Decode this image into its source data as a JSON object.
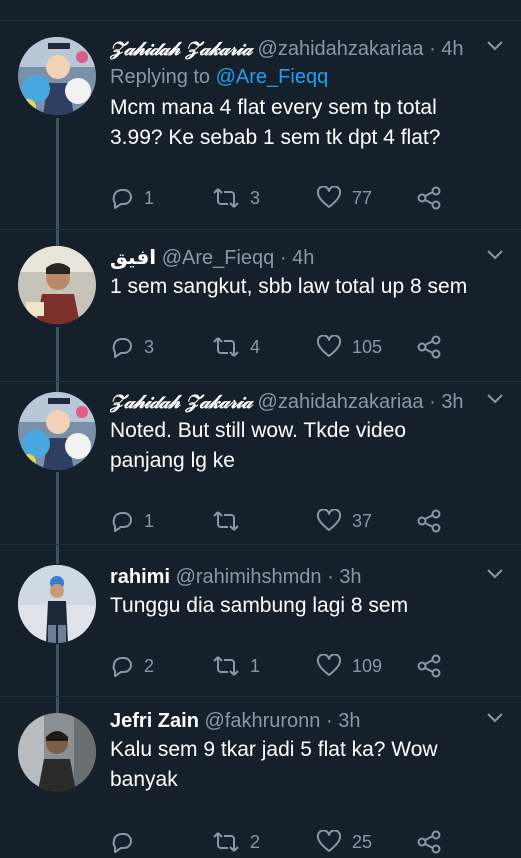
{
  "tweets": [
    {
      "name": "𝒵𝒶𝒽𝒾𝒹𝒶𝒽 𝒵𝒶𝓀𝒶𝓇𝒾𝒶",
      "handle": "@zahidahzakariaa",
      "dot": "·",
      "time": "4h",
      "replying_prefix": "Replying to",
      "replying_to": "@Are_Fieqq",
      "text_lines": [
        "Mcm mana 4 flat every sem tp total",
        "3.99? Ke sebab 1 sem tk dpt 4 flat?"
      ],
      "reply_count": "1",
      "retweet_count": "3",
      "like_count": "77"
    },
    {
      "name": "افيق",
      "handle": "@Are_Fieqq",
      "dot": "·",
      "time": "4h",
      "text_lines": [
        "1 sem sangkut, sbb law total up 8 sem"
      ],
      "reply_count": "3",
      "retweet_count": "4",
      "like_count": "105"
    },
    {
      "name": "𝒵𝒶𝒽𝒾𝒹𝒶𝒽 𝒵𝒶𝓀𝒶𝓇𝒾𝒶",
      "handle": "@zahidahzakariaa",
      "dot": "·",
      "time": "3h",
      "text_lines": [
        "Noted.  But still wow.  Tkde video",
        "panjang lg ke"
      ],
      "reply_count": "1",
      "retweet_count": "",
      "like_count": "37"
    },
    {
      "name": "rahimi",
      "handle": "@rahimihshmdn",
      "dot": "·",
      "time": "3h",
      "text_lines": [
        "Tunggu dia sambung lagi 8 sem"
      ],
      "reply_count": "2",
      "retweet_count": "1",
      "like_count": "109"
    },
    {
      "name": "Jefri Zain",
      "handle": "@fakhruronn",
      "dot": "·",
      "time": "3h",
      "text_lines": [
        "Kalu sem 9 tkar jadi 5 flat ka? Wow",
        "banyak"
      ],
      "reply_count": "",
      "retweet_count": "2",
      "like_count": "25"
    }
  ],
  "icons": {
    "reply": "reply-icon",
    "retweet": "retweet-icon",
    "like": "heart-icon",
    "share": "share-icon",
    "more": "chevron-down-icon"
  },
  "colors": {
    "background": "#15202b",
    "text": "#ffffff",
    "secondary": "#8899a6",
    "accent": "#1da1f2",
    "divider": "#22303c",
    "thread_line": "#3d5466"
  }
}
